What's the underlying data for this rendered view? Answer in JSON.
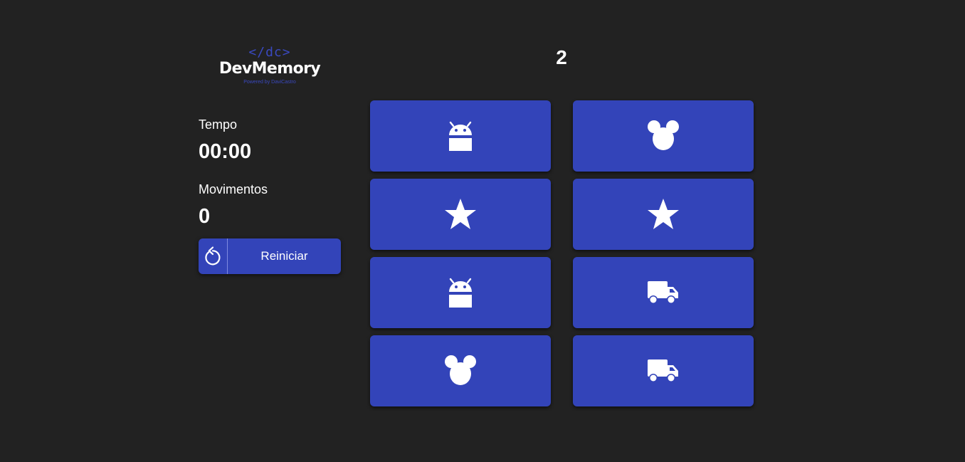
{
  "logo": {
    "mark": "</dc>",
    "wordmark": "DevMemory",
    "powered_by": "Powered by DaviCastro"
  },
  "round": "2",
  "stats": {
    "time_label": "Tempo",
    "time_value": "00:00",
    "moves_label": "Movimentos",
    "moves_value": "0"
  },
  "restart": {
    "label": "Reiniciar",
    "icon": "rotate-ccw-icon"
  },
  "cards": [
    {
      "icon": "android-icon",
      "face": "revealed"
    },
    {
      "icon": "mouse-ears-icon",
      "face": "revealed"
    },
    {
      "icon": "star-icon",
      "face": "revealed"
    },
    {
      "icon": "star-icon",
      "face": "revealed"
    },
    {
      "icon": "android-icon",
      "face": "revealed"
    },
    {
      "icon": "truck-icon",
      "face": "revealed"
    },
    {
      "icon": "mouse-ears-icon",
      "face": "revealed"
    },
    {
      "icon": "truck-icon",
      "face": "revealed"
    }
  ],
  "colors": {
    "background": "#222222",
    "card": "#3344b9",
    "accent": "#3a49c0",
    "text": "#ffffff"
  }
}
